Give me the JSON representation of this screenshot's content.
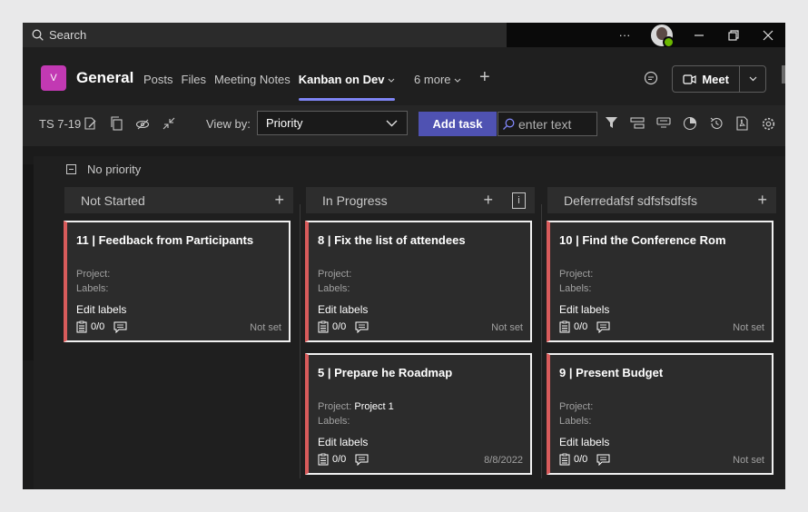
{
  "titlebar": {
    "search_placeholder": "Search",
    "more": "···"
  },
  "header": {
    "team_initial": "V",
    "channel": "General",
    "tabs": [
      {
        "label": "Posts"
      },
      {
        "label": "Files"
      },
      {
        "label": "Meeting Notes"
      },
      {
        "label": "Kanban on Dev"
      },
      {
        "label": "6 more"
      }
    ],
    "meet_label": "Meet"
  },
  "toolbar": {
    "sprint": "TS 7-19",
    "view_by_label": "View by:",
    "view_by_value": "Priority",
    "add_task": "Add task",
    "search_placeholder": "enter text"
  },
  "board": {
    "swimlane": "No priority",
    "columns": [
      {
        "title": "Not Started"
      },
      {
        "title": "In Progress"
      },
      {
        "title": "Deferredafsf sdfsfsdfsfs"
      }
    ],
    "cards": [
      {
        "title": "11 | Feedback from Participants",
        "project_label": "Project:",
        "project": "",
        "labels_label": "Labels:",
        "edit": "Edit labels",
        "checklist": "0/0",
        "due": "Not set"
      },
      {
        "title": "8 | Fix the list of attendees",
        "project_label": "Project:",
        "project": "",
        "labels_label": "Labels:",
        "edit": "Edit labels",
        "checklist": "0/0",
        "due": "Not set"
      },
      {
        "title": "10 | Find the Conference Rom",
        "project_label": "Project:",
        "project": "",
        "labels_label": "Labels:",
        "edit": "Edit labels",
        "checklist": "0/0",
        "due": "Not set"
      },
      {
        "title": "5 | Prepare he Roadmap",
        "project_label": "Project:",
        "project": "Project 1",
        "labels_label": "Labels:",
        "edit": "Edit labels",
        "checklist": "0/0",
        "due": "8/8/2022"
      },
      {
        "title": "9 | Present Budget",
        "project_label": "Project:",
        "project": "",
        "labels_label": "Labels:",
        "edit": "Edit labels",
        "checklist": "0/0",
        "due": "Not set"
      }
    ]
  },
  "colors": {
    "accent": "#4f52b2",
    "tab_underline": "#7f85f5",
    "team": "#c239b3",
    "card_stripe": "#d85b5b"
  }
}
